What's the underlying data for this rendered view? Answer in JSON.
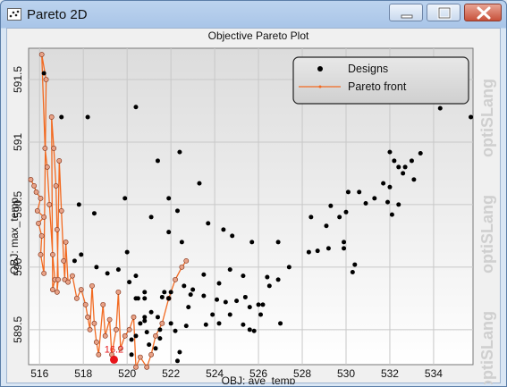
{
  "window": {
    "title": "Pareto 2D",
    "controls": {
      "minimize": "minimize-icon",
      "maximize": "maximize-icon",
      "close": "close-icon"
    }
  },
  "watermark": "optiSLang",
  "chart_data": {
    "type": "scatter",
    "title": "Objective Pareto Plot",
    "xlabel": "OBJ: ave_temp",
    "ylabel": "OBJ: max_temp",
    "xlim": [
      515.5,
      535.8
    ],
    "ylim": [
      589.22,
      591.75
    ],
    "x_ticks": [
      516,
      518,
      520,
      522,
      524,
      526,
      528,
      530,
      532,
      534
    ],
    "y_ticks": [
      589.5,
      590,
      590.5,
      591,
      591.5
    ],
    "y_tick_labels": [
      "589.5",
      "590",
      "590.5",
      "591",
      "591.5"
    ],
    "grid": true,
    "legend": {
      "position": "top-right",
      "entries": [
        "Designs",
        "Pareto front"
      ]
    },
    "colors": {
      "designs": "#000000",
      "pareto_front": "#f26a21",
      "pareto_marker_fill": "#e8a287",
      "selected": "#e8141a"
    },
    "selected_point": {
      "label": "16.2",
      "x": 519.4,
      "y": 589.26
    },
    "series": [
      {
        "name": "Designs",
        "points": [
          [
            516.2,
            591.55
          ],
          [
            517.0,
            591.2
          ],
          [
            518.2,
            591.2
          ],
          [
            520.4,
            591.28
          ],
          [
            522.4,
            590.92
          ],
          [
            521.4,
            590.85
          ],
          [
            521.9,
            590.55
          ],
          [
            523.3,
            590.67
          ],
          [
            517.8,
            590.5
          ],
          [
            518.5,
            590.43
          ],
          [
            519.9,
            590.55
          ],
          [
            521.1,
            590.4
          ],
          [
            522.3,
            590.45
          ],
          [
            524.4,
            590.3
          ],
          [
            523.7,
            590.35
          ],
          [
            522.5,
            590.2
          ],
          [
            521.9,
            590.28
          ],
          [
            524.8,
            590.25
          ],
          [
            525.7,
            590.2
          ],
          [
            526.9,
            590.2
          ],
          [
            527.4,
            590.0
          ],
          [
            528.4,
            590.4
          ],
          [
            529.1,
            590.33
          ],
          [
            529.7,
            590.4
          ],
          [
            530.0,
            590.44
          ],
          [
            529.3,
            590.49
          ],
          [
            530.6,
            590.6
          ],
          [
            530.1,
            590.6
          ],
          [
            530.9,
            590.51
          ],
          [
            531.3,
            590.55
          ],
          [
            531.7,
            590.67
          ],
          [
            532.0,
            590.64
          ],
          [
            532.2,
            590.85
          ],
          [
            532.0,
            590.92
          ],
          [
            532.7,
            590.8
          ],
          [
            533.0,
            590.85
          ],
          [
            533.4,
            590.91
          ],
          [
            532.6,
            590.75
          ],
          [
            532.4,
            590.8
          ],
          [
            531.9,
            590.52
          ],
          [
            532.4,
            590.5
          ],
          [
            533.1,
            590.7
          ],
          [
            534.3,
            591.27
          ],
          [
            535.7,
            591.2
          ],
          [
            532.1,
            590.42
          ],
          [
            529.2,
            590.15
          ],
          [
            528.7,
            590.13
          ],
          [
            528.3,
            590.12
          ],
          [
            529.9,
            590.2
          ],
          [
            530.4,
            590.02
          ],
          [
            530.3,
            589.96
          ],
          [
            529.9,
            590.15
          ],
          [
            526.4,
            589.92
          ],
          [
            526.5,
            589.85
          ],
          [
            526.9,
            589.9
          ],
          [
            525.3,
            589.93
          ],
          [
            524.7,
            589.98
          ],
          [
            524.2,
            589.87
          ],
          [
            523.5,
            589.94
          ],
          [
            523.0,
            589.82
          ],
          [
            522.6,
            589.85
          ],
          [
            522.0,
            589.8
          ],
          [
            522.9,
            589.78
          ],
          [
            523.5,
            589.77
          ],
          [
            524.1,
            589.74
          ],
          [
            524.5,
            589.72
          ],
          [
            525.4,
            589.76
          ],
          [
            525.0,
            589.73
          ],
          [
            524.7,
            589.62
          ],
          [
            523.9,
            589.62
          ],
          [
            523.6,
            589.54
          ],
          [
            524.2,
            589.55
          ],
          [
            525.6,
            589.68
          ],
          [
            526.0,
            589.7
          ],
          [
            526.2,
            589.7
          ],
          [
            526.1,
            589.62
          ],
          [
            525.3,
            589.54
          ],
          [
            525.6,
            589.5
          ],
          [
            525.8,
            589.49
          ],
          [
            527.0,
            589.55
          ],
          [
            522.7,
            589.53
          ],
          [
            522.2,
            589.49
          ],
          [
            521.5,
            589.43
          ],
          [
            521.0,
            589.38
          ],
          [
            521.3,
            589.35
          ],
          [
            522.4,
            589.32
          ],
          [
            520.8,
            589.6
          ],
          [
            520.6,
            589.55
          ],
          [
            520.4,
            589.45
          ],
          [
            520.2,
            589.42
          ],
          [
            520.1,
            589.88
          ],
          [
            519.6,
            589.98
          ],
          [
            518.6,
            590.0
          ],
          [
            519.1,
            589.95
          ],
          [
            520.4,
            589.93
          ],
          [
            520.8,
            589.8
          ],
          [
            520.4,
            589.75
          ],
          [
            520.5,
            589.75
          ],
          [
            520.8,
            589.75
          ],
          [
            521.6,
            589.76
          ],
          [
            521.1,
            589.64
          ],
          [
            521.4,
            589.6
          ],
          [
            522.0,
            589.55
          ],
          [
            520.9,
            589.48
          ],
          [
            521.5,
            589.5
          ],
          [
            517.6,
            590.05
          ],
          [
            517.9,
            590.1
          ],
          [
            520.0,
            590.12
          ],
          [
            521.9,
            589.75
          ],
          [
            522.8,
            589.68
          ],
          [
            522.3,
            589.25
          ],
          [
            520.2,
            589.3
          ],
          [
            521.7,
            589.8
          ],
          [
            520.8,
            589.57
          ]
        ]
      },
      {
        "name": "Pareto front",
        "points": [
          [
            515.6,
            590.7
          ],
          [
            515.75,
            590.65
          ],
          [
            515.85,
            590.6
          ],
          [
            516.05,
            590.55
          ],
          [
            515.9,
            590.45
          ],
          [
            516.2,
            590.4
          ],
          [
            515.95,
            590.35
          ],
          [
            516.1,
            590.25
          ],
          [
            516.05,
            590.1
          ],
          [
            516.2,
            589.95
          ],
          [
            516.3,
            591.5
          ],
          [
            516.1,
            591.7
          ],
          [
            516.25,
            590.95
          ],
          [
            516.35,
            590.8
          ],
          [
            516.45,
            590.5
          ],
          [
            516.6,
            590.1
          ],
          [
            516.7,
            589.9
          ],
          [
            516.6,
            589.82
          ],
          [
            516.55,
            591.2
          ],
          [
            516.65,
            590.95
          ],
          [
            516.75,
            590.65
          ],
          [
            516.8,
            590.3
          ],
          [
            516.85,
            589.9
          ],
          [
            516.8,
            589.8
          ],
          [
            516.9,
            590.85
          ],
          [
            517.0,
            590.45
          ],
          [
            517.1,
            590.05
          ],
          [
            517.15,
            589.9
          ],
          [
            517.2,
            590.2
          ],
          [
            517.3,
            589.88
          ],
          [
            517.5,
            589.93
          ],
          [
            517.7,
            589.75
          ],
          [
            517.9,
            589.82
          ],
          [
            518.1,
            589.7
          ],
          [
            518.2,
            589.6
          ],
          [
            518.3,
            589.5
          ],
          [
            518.4,
            589.85
          ],
          [
            518.5,
            589.55
          ],
          [
            518.6,
            589.4
          ],
          [
            518.7,
            589.3
          ],
          [
            518.9,
            589.7
          ],
          [
            519.0,
            589.45
          ],
          [
            519.2,
            589.58
          ],
          [
            519.3,
            589.3
          ],
          [
            519.5,
            589.5
          ],
          [
            519.6,
            589.8
          ],
          [
            519.7,
            589.35
          ],
          [
            519.9,
            589.45
          ],
          [
            520.1,
            589.5
          ],
          [
            520.3,
            589.6
          ],
          [
            520.4,
            589.2
          ],
          [
            520.6,
            589.28
          ],
          [
            520.9,
            589.2
          ],
          [
            521.1,
            589.3
          ],
          [
            521.3,
            589.45
          ],
          [
            521.6,
            589.55
          ],
          [
            521.9,
            589.75
          ],
          [
            522.2,
            589.9
          ],
          [
            522.5,
            590.0
          ],
          [
            522.7,
            590.05
          ]
        ]
      }
    ]
  }
}
